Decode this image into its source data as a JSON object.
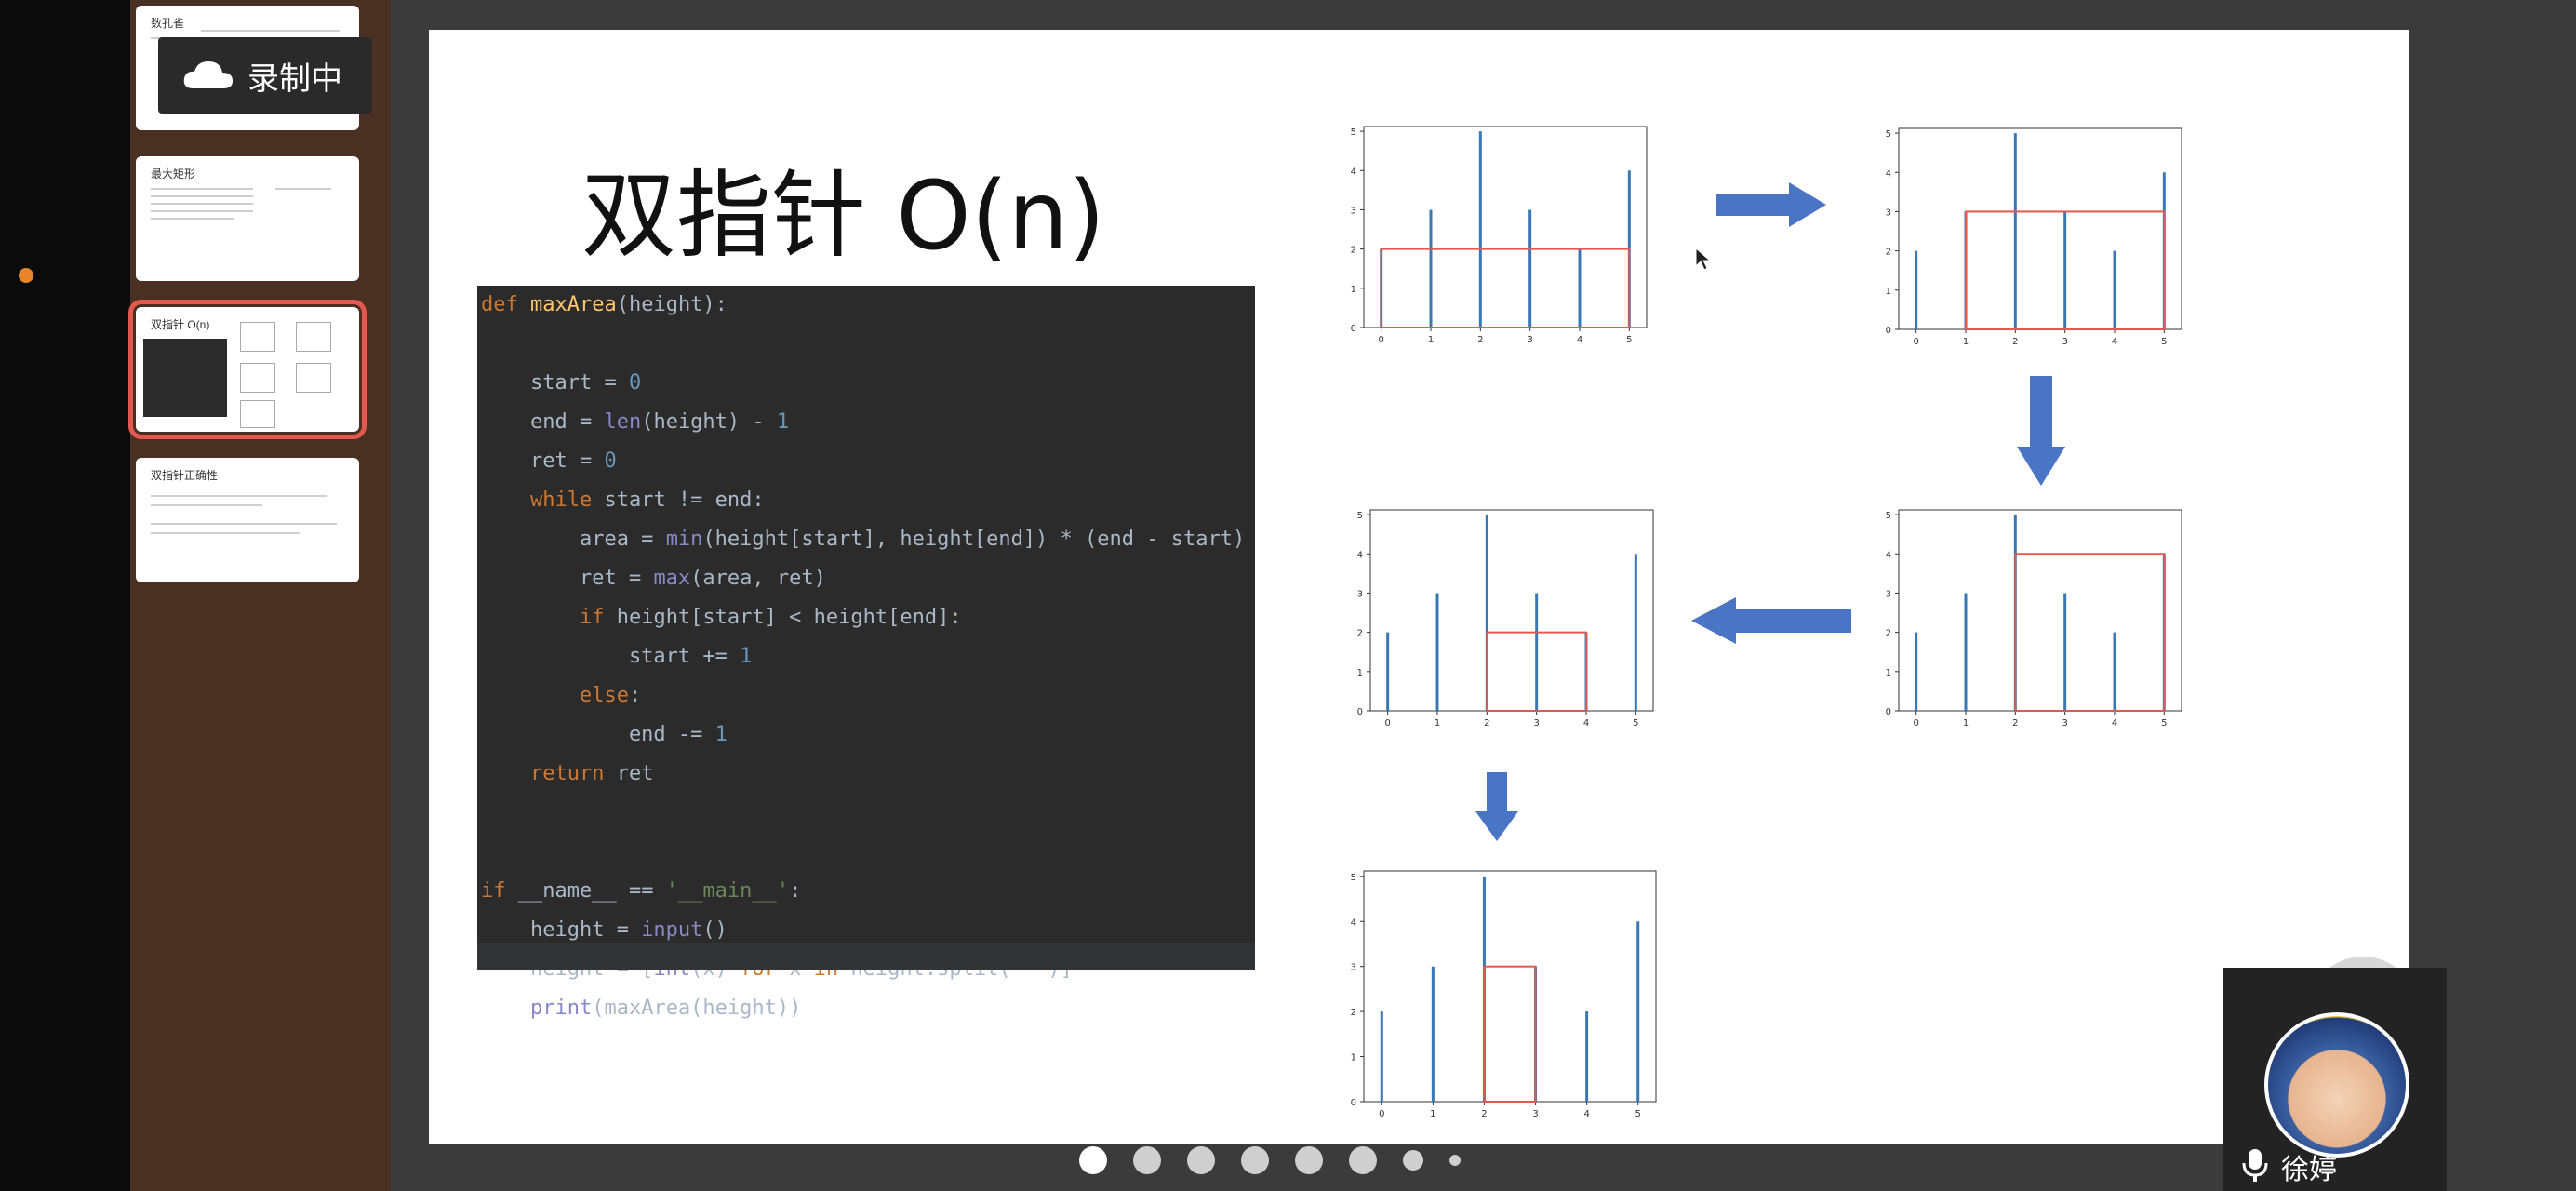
{
  "recording": {
    "label": "录制中"
  },
  "thumbnails": [
    {
      "title": "数孔雀"
    },
    {
      "title": "最大矩形"
    },
    {
      "title": "双指针 O(n)"
    },
    {
      "title": "双指针正确性"
    }
  ],
  "slide": {
    "title": "双指针 O(n)",
    "code_lines": [
      "def maxArea(height):",
      "",
      "    start = 0",
      "    end = len(height) - 1",
      "    ret = 0",
      "    while start != end:",
      "        area = min(height[start], height[end]) * (end - start)",
      "        ret = max(area, ret)",
      "        if height[start] < height[end]:",
      "            start += 1",
      "        else:",
      "            end -= 1",
      "    return ret",
      "",
      "",
      "if __name__ == '__main__':",
      "    height = input()",
      "    height = [int(x) for x in height.split(' ')]",
      "    print(maxArea(height))"
    ]
  },
  "chart_data": [
    {
      "type": "bar",
      "x": [
        0,
        1,
        2,
        3,
        4,
        5
      ],
      "values": [
        2,
        3,
        5,
        3,
        2,
        4
      ],
      "ylim": [
        0,
        5
      ],
      "xticks": [
        "0",
        "1",
        "2",
        "3",
        "4",
        "5"
      ],
      "yticks": [
        "0",
        "1",
        "2",
        "3",
        "4",
        "5"
      ],
      "highlight": {
        "x_start": 0,
        "x_end": 5,
        "height": 2
      }
    },
    {
      "type": "bar",
      "x": [
        0,
        1,
        2,
        3,
        4,
        5
      ],
      "values": [
        2,
        3,
        5,
        3,
        2,
        4
      ],
      "ylim": [
        0,
        5
      ],
      "xticks": [
        "0",
        "1",
        "2",
        "3",
        "4",
        "5"
      ],
      "yticks": [
        "0",
        "1",
        "2",
        "3",
        "4",
        "5"
      ],
      "highlight": {
        "x_start": 1,
        "x_end": 5,
        "height": 3
      }
    },
    {
      "type": "bar",
      "x": [
        0,
        1,
        2,
        3,
        4,
        5
      ],
      "values": [
        2,
        3,
        5,
        3,
        2,
        4
      ],
      "ylim": [
        0,
        5
      ],
      "xticks": [
        "0",
        "1",
        "2",
        "3",
        "4",
        "5"
      ],
      "yticks": [
        "0",
        "1",
        "2",
        "3",
        "4",
        "5"
      ],
      "highlight": {
        "x_start": 2,
        "x_end": 5,
        "height": 4
      }
    },
    {
      "type": "bar",
      "x": [
        0,
        1,
        2,
        3,
        4,
        5
      ],
      "values": [
        2,
        3,
        5,
        3,
        2,
        4
      ],
      "ylim": [
        0,
        5
      ],
      "xticks": [
        "0",
        "1",
        "2",
        "3",
        "4",
        "5"
      ],
      "yticks": [
        "0",
        "1",
        "2",
        "3",
        "4",
        "5"
      ],
      "highlight": {
        "x_start": 2,
        "x_end": 4,
        "height": 2
      }
    },
    {
      "type": "bar",
      "x": [
        0,
        1,
        2,
        3,
        4,
        5
      ],
      "values": [
        2,
        3,
        5,
        3,
        2,
        4
      ],
      "ylim": [
        0,
        5
      ],
      "xticks": [
        "0",
        "1",
        "2",
        "3",
        "4",
        "5"
      ],
      "yticks": [
        "0",
        "1",
        "2",
        "3",
        "4",
        "5"
      ],
      "highlight": {
        "x_start": 2,
        "x_end": 3,
        "height": 3
      }
    }
  ],
  "pagination": {
    "total": 8,
    "current": 1
  },
  "participant": {
    "name": "徐婷"
  },
  "colors": {
    "bar": "#3a78b5",
    "highlight": "#e3584f",
    "arrow": "#4a74c4"
  }
}
